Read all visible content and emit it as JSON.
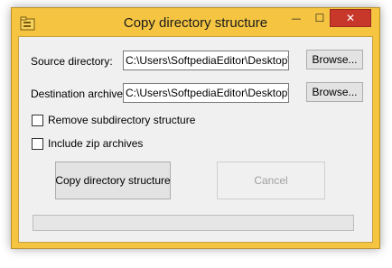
{
  "window": {
    "title": "Copy directory structure",
    "minimize_glyph": "—",
    "maximize_glyph": "☐",
    "close_glyph": "✕"
  },
  "form": {
    "source_label": "Source directory:",
    "source_value": "C:\\Users\\SoftpediaEditor\\Desktop\\Sc",
    "source_browse": "Browse...",
    "dest_label": "Destination archive:",
    "dest_value": "C:\\Users\\SoftpediaEditor\\Desktop\\Sc",
    "dest_browse": "Browse...",
    "remove_subdir_label": "Remove subdirectory structure",
    "remove_subdir_checked": false,
    "include_zip_label": "Include zip archives",
    "include_zip_checked": false
  },
  "actions": {
    "copy_label": "Copy directory structure",
    "cancel_label": "Cancel"
  },
  "progress": {
    "value": 0
  },
  "icons": {
    "app": "folder-app-icon"
  },
  "colors": {
    "frame": "#f5c542",
    "close": "#c7382b",
    "client": "#f0f0f0"
  }
}
